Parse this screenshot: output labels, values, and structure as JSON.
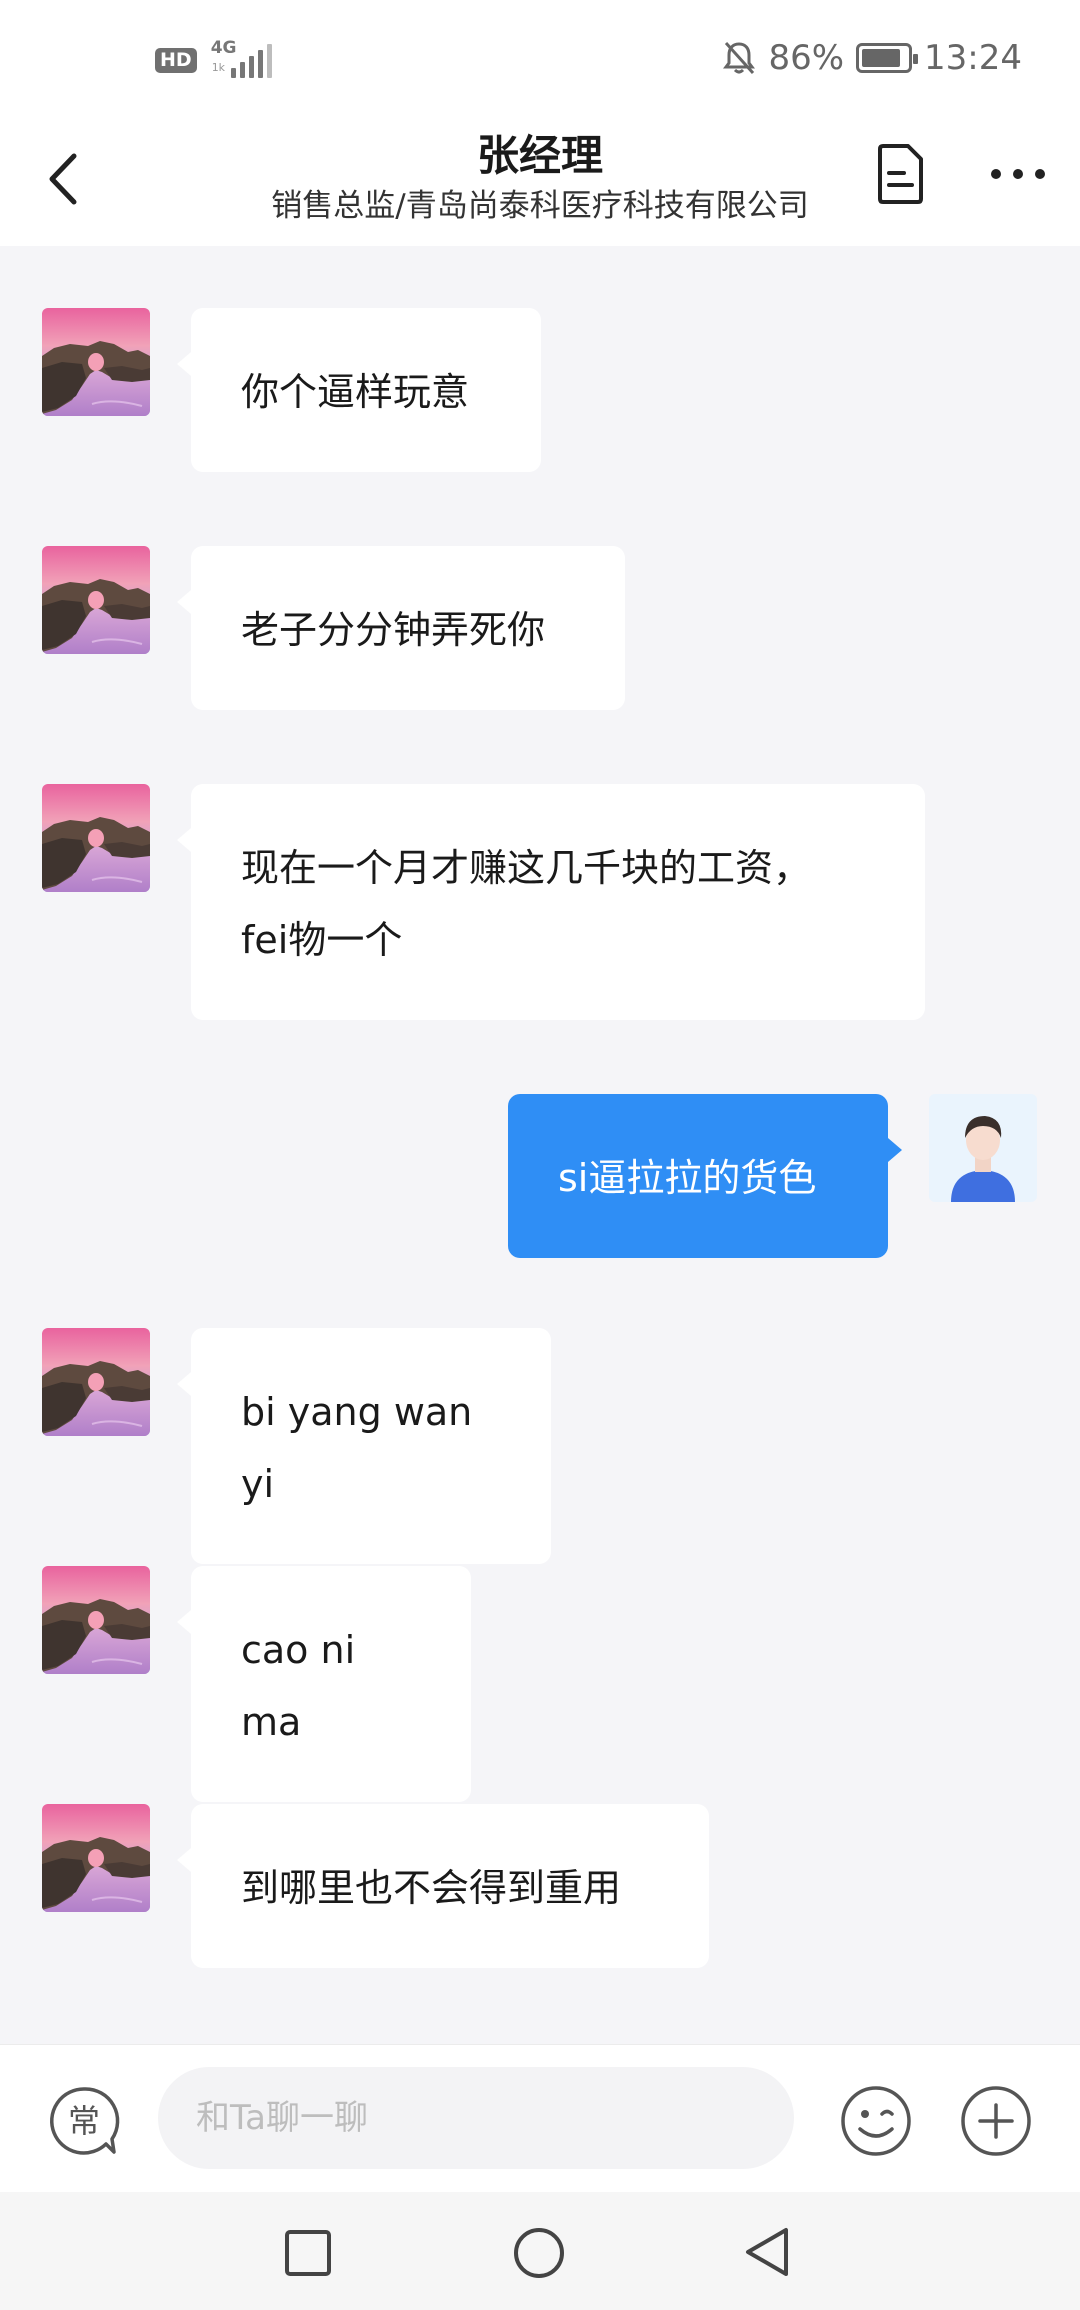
{
  "status_bar": {
    "hd": "HD",
    "network": "4G",
    "network_sub": "1k",
    "battery_percent": "86%",
    "battery_level": 0.86,
    "time": "13:24"
  },
  "header": {
    "title": "张经理",
    "subtitle": "销售总监/青岛尚泰科医疗科技有限公司"
  },
  "messages": [
    {
      "side": "left",
      "lines": [
        "你个逼样玩意"
      ]
    },
    {
      "side": "left",
      "lines": [
        "老子分分钟弄死你"
      ]
    },
    {
      "side": "left",
      "lines": [
        "现在一个月才赚这几千块的工资，",
        "fei物一个"
      ]
    },
    {
      "side": "right",
      "lines": [
        "si逼拉拉的货色"
      ]
    },
    {
      "side": "left",
      "lines": [
        "bi yang wan yi"
      ]
    },
    {
      "side": "left",
      "lines": [
        "cao ni ma"
      ]
    },
    {
      "side": "left",
      "lines": [
        "到哪里也不会得到重用"
      ]
    }
  ],
  "input_bar": {
    "common_label": "常",
    "placeholder": "和Ta聊一聊"
  },
  "colors": {
    "bubble_mine": "#2f8ef5",
    "bubble_other": "#ffffff",
    "chat_background": "#f5f5f8"
  },
  "icons": [
    "back-icon",
    "document-icon",
    "more-icon",
    "mute-bell-icon",
    "battery-icon",
    "emoji-icon",
    "plus-icon",
    "nav-recent-icon",
    "nav-home-icon",
    "nav-back-icon"
  ]
}
